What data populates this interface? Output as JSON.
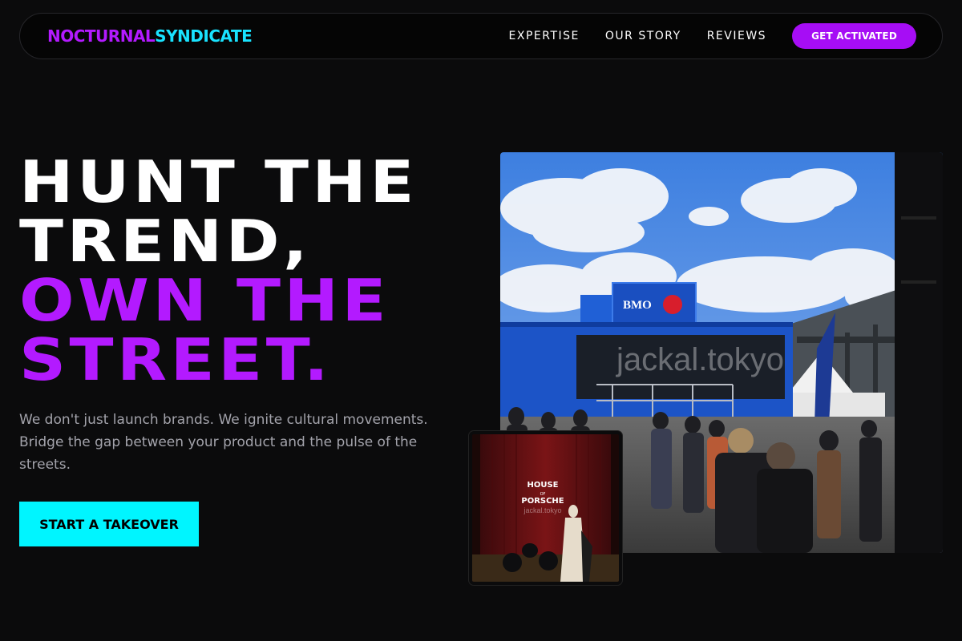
{
  "nav": {
    "logo_part1": "NOCTURNAL",
    "logo_part2": "SYNDICATE",
    "links": [
      "EXPERTISE",
      "OUR STORY",
      "REVIEWS"
    ],
    "cta": "GET ACTIVATED"
  },
  "hero": {
    "title_line1": "HUNT THE",
    "title_line2": "TREND,",
    "title_line3": "OWN THE",
    "title_line4": "STREET.",
    "description": "We don't just launch brands. We ignite cultural movements. Bridge the gap between your product and the pulse of the streets.",
    "cta": "START A TAKEOVER"
  },
  "photos": {
    "main": {
      "sign_text": "BMO",
      "watermark": "jackal.tokyo"
    },
    "inset": {
      "sign_line1": "HOUSE",
      "sign_line2": "OF",
      "sign_line3": "PORSCHE",
      "watermark": "jackal.tokyo"
    }
  },
  "colors": {
    "accent_purple": "#b31aff",
    "accent_cyan": "#00f5ff",
    "background": "#0b0b0c"
  }
}
